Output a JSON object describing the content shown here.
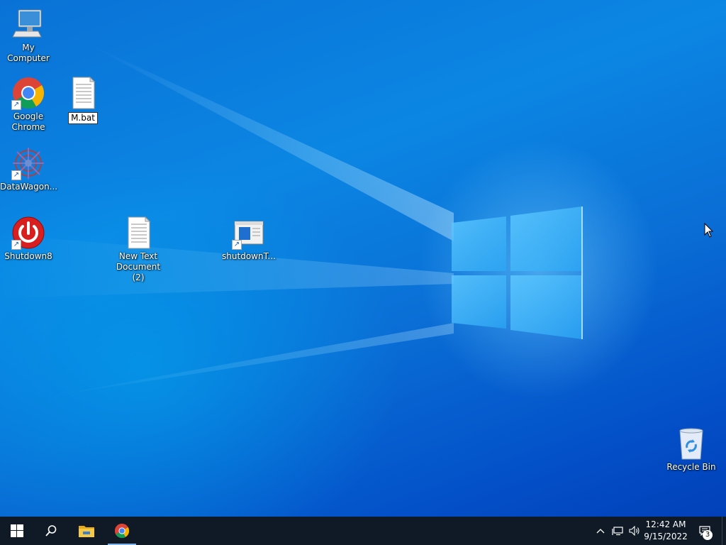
{
  "desktop_icons": {
    "my_computer": "My Computer",
    "google_chrome": "Google Chrome",
    "m_bat": "M.bat",
    "datawagon": "DataWagon...",
    "shutdown8": "Shutdown8",
    "new_text_document": "New Text Document (2)",
    "shutdownt": "shutdownT...",
    "recycle_bin": "Recycle Bin"
  },
  "taskbar": {
    "clock_time": "12:42 AM",
    "clock_date": "9/15/2022",
    "notification_count": "3"
  },
  "colors": {
    "taskbar": "#0f1a26",
    "desktop_blue": "#0a72d6",
    "active_indicator": "#7fb2e8"
  }
}
